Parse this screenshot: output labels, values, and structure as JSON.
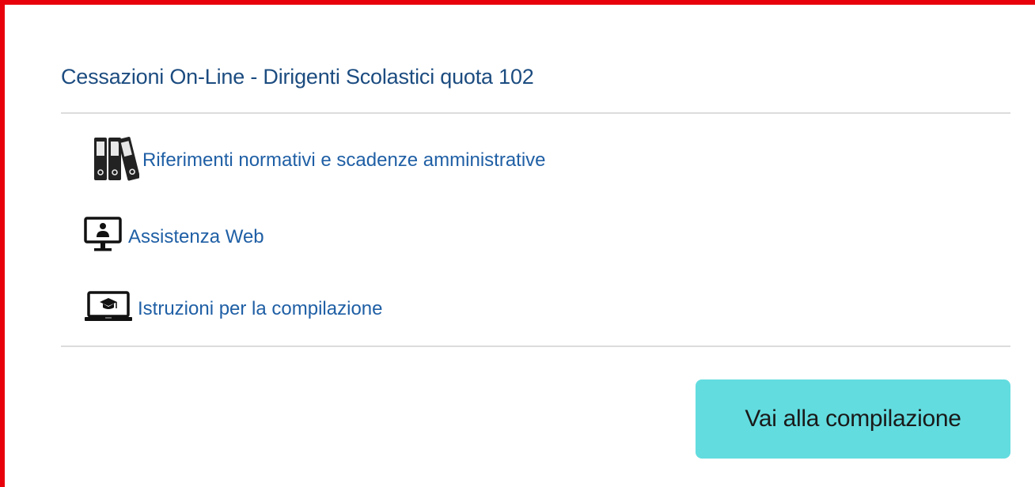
{
  "card": {
    "title": "Cessazioni On-Line - Dirigenti Scolastici quota 102",
    "border_color": "#e8000b"
  },
  "links": [
    {
      "label": "Riferimenti normativi e scadenze amministrative",
      "icon": "binders-icon"
    },
    {
      "label": "Assistenza Web",
      "icon": "monitor-user-icon"
    },
    {
      "label": "Istruzioni per la compilazione",
      "icon": "laptop-graduation-icon"
    }
  ],
  "cta": {
    "label": "Vai alla compilazione",
    "color": "#62dcdf"
  },
  "colors": {
    "title": "#1c4c80",
    "link": "#1f5fa5",
    "divider": "#dcdcdc"
  }
}
